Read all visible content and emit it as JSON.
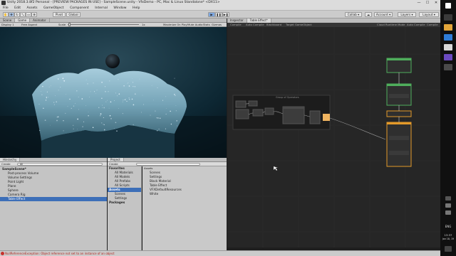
{
  "window": {
    "title": "Unity 2018.3.8f2 Personal - [PREVIEW PACKAGES IN USE] - SampleScene.unity - VfxDemo - PC, Mac & Linux Standalone* <DX11>",
    "controls": [
      "—",
      "☐",
      "✕"
    ]
  },
  "menu": [
    "File",
    "Edit",
    "Assets",
    "GameObject",
    "Component",
    "Internal",
    "Window",
    "Help"
  ],
  "toolbar": {
    "pivot": "Pivot",
    "global": "Global",
    "collab": "Collab",
    "account": "Account",
    "layers": "Layers",
    "layout": "Layout"
  },
  "scene_panel": {
    "tabs": [
      "Scene",
      "Game",
      "Animator"
    ],
    "active_tab": "Game",
    "display": "Display 1",
    "aspect": "Free Aspect",
    "scale_label": "Scale",
    "scale_value": "1x",
    "right_buttons": [
      "Maximize On Play",
      "Mute Audio",
      "Stats",
      "Gizmos"
    ]
  },
  "hierarchy": {
    "tab": "Hierarchy",
    "create": "Create",
    "search_placeholder": "All",
    "items": [
      {
        "label": "SampleScene*",
        "bold": true,
        "indent": 0,
        "selected": false
      },
      {
        "label": "Post-process Volume",
        "indent": 1,
        "selected": false
      },
      {
        "label": "Volume Settings",
        "indent": 1,
        "selected": false
      },
      {
        "label": "Point Light",
        "indent": 1,
        "selected": false
      },
      {
        "label": "Plane",
        "indent": 1,
        "selected": false
      },
      {
        "label": "Sphere",
        "indent": 1,
        "selected": false
      },
      {
        "label": "Camera Rig",
        "indent": 1,
        "selected": false
      },
      {
        "label": "Table Effect",
        "indent": 1,
        "selected": true
      }
    ]
  },
  "project": {
    "tab": "Project",
    "create": "Create",
    "tree": [
      {
        "label": "Favorites",
        "bold": true,
        "indent": 0
      },
      {
        "label": "All Materials",
        "indent": 1
      },
      {
        "label": "All Models",
        "indent": 1
      },
      {
        "label": "All Prefabs",
        "indent": 1
      },
      {
        "label": "All Scripts",
        "indent": 1
      },
      {
        "label": "Assets",
        "bold": true,
        "indent": 0,
        "selected": true
      },
      {
        "label": "Scenes",
        "indent": 1
      },
      {
        "label": "Settings",
        "indent": 1
      },
      {
        "label": "Packages",
        "bold": true,
        "indent": 0
      }
    ],
    "breadcrumb": "Assets",
    "files": [
      "Scenes",
      "Settings",
      "Black Material",
      "Table Effect",
      "VFXDefaultResources",
      "White"
    ]
  },
  "vfx": {
    "tabs": [
      "Inspector",
      "Table Effect*"
    ],
    "active_tab": "Table Effect*",
    "toolbar": [
      "Compile",
      "Auto Compile",
      "Blackboard",
      "Target GameObject",
      "Cloud Runtime Mode",
      "Auto Compile",
      "Compile"
    ],
    "group_title": "Group of Operators"
  },
  "taskbar": {
    "lang": "ENG",
    "time": "13:37",
    "date": "Jan 18, 19"
  },
  "status": {
    "message": "NullReferenceException: Object reference not set to an instance of an object"
  },
  "colors": {
    "accent_green": "#4fae5c",
    "accent_orange": "#e39a2a",
    "node_yellow": "#f0b460",
    "selection_blue": "#3d6fb8",
    "error_red": "#c8322d"
  }
}
